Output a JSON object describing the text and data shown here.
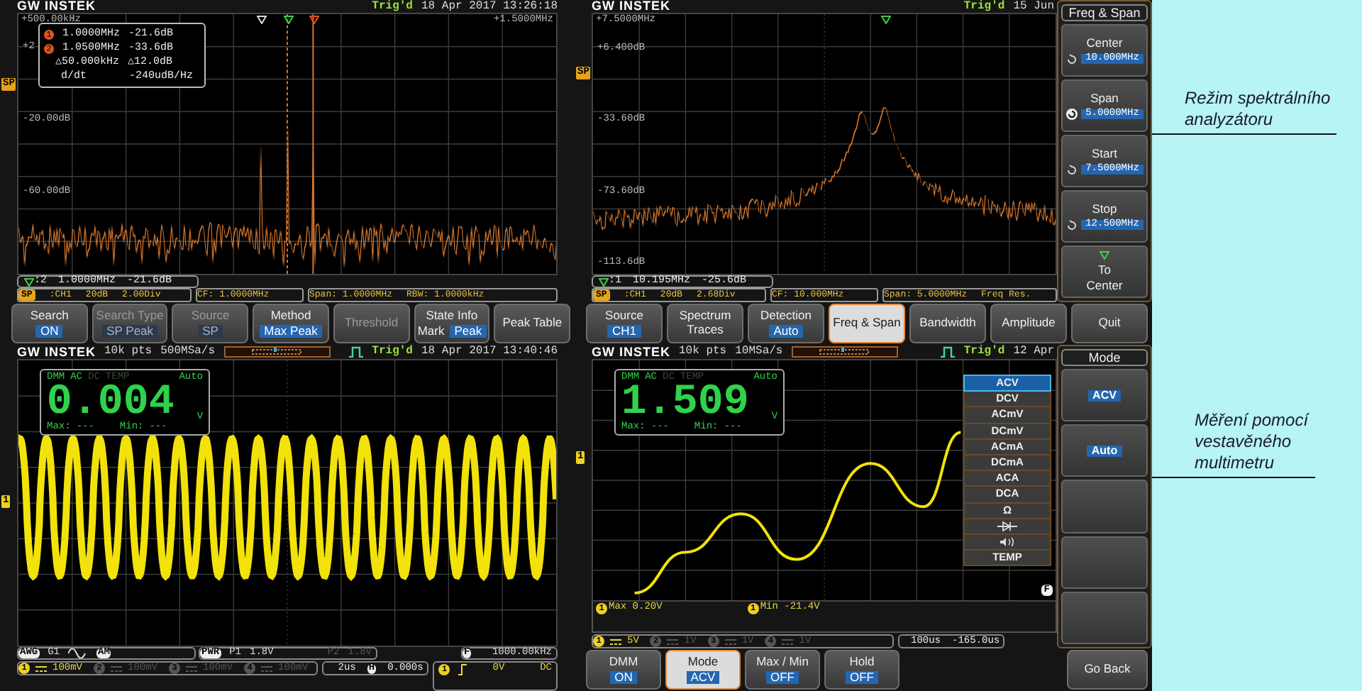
{
  "spectrum_view": {
    "header": {
      "brand": "GW INSTEK",
      "trigger": "Trig'd",
      "datetime": "18 Apr 2017 13:26:18"
    },
    "channel_tag": "SP",
    "x_start": "+500.00kHz",
    "x_end": "+1.5000MHz",
    "y_labels": [
      "+2",
      "-20.00dB",
      "-60.00dB"
    ],
    "marker_table": {
      "rows": [
        {
          "id": "1",
          "freq": "1.0000MHz",
          "level": "-21.6dB"
        },
        {
          "id": "2",
          "freq": "1.0500MHz",
          "level": "-33.6dB"
        }
      ],
      "delta_freq": "△50.000kHz",
      "delta_level": "△12.0dB",
      "rate_label": "d/dt",
      "rate": "-240udB/Hz"
    },
    "readout": {
      "marker": ":2",
      "freq": "1.0000MHz",
      "level": "-21.6dB"
    },
    "status_tag": "SP",
    "status": [
      [
        ":CH1",
        "20dB",
        "2.00Div"
      ],
      [
        "CF: 1.0000MHz"
      ],
      [
        "Span: 1.0000MHz",
        "RBW: 1.0000kHz"
      ]
    ],
    "softkeys": [
      {
        "label": "Search",
        "value": [
          {
            "text": "ON",
            "selected": true
          }
        ],
        "disabled": false,
        "selected": false
      },
      {
        "label": "Search Type",
        "value": [
          {
            "text": "SP Peak",
            "selected": true
          }
        ],
        "disabled": true,
        "selected": false
      },
      {
        "label": "Source",
        "value": [
          {
            "text": "SP",
            "selected": true
          }
        ],
        "disabled": true,
        "selected": false
      },
      {
        "label": "Method",
        "value": [
          {
            "text": "Max Peak",
            "selected": true
          }
        ],
        "disabled": false,
        "selected": false
      },
      {
        "label": "Threshold",
        "disabled": true,
        "selected": false
      },
      {
        "label": "State Info",
        "value": [
          {
            "text": "Mark",
            "selected": false
          },
          {
            "text": "Peak",
            "selected": true
          }
        ],
        "disabled": false,
        "selected": false
      },
      {
        "label": "Peak Table",
        "disabled": false,
        "selected": false
      }
    ]
  },
  "span_view": {
    "header": {
      "brand": "GW INSTEK",
      "trigger": "Trig'd",
      "datetime": "15 Jun"
    },
    "channel_tag": "SP",
    "x_start": "+7.5000MHz",
    "y_labels": [
      "+6.400dB",
      "-33.60dB",
      "-73.60dB",
      "-113.6dB"
    ],
    "readout": {
      "marker": ":1",
      "freq": "10.195MHz",
      "level": "-25.6dB"
    },
    "status_tag": "SP",
    "status": [
      [
        ":CH1",
        "20dB",
        "2.68Div"
      ],
      [
        "CF: 10.000MHz"
      ],
      [
        "Span: 5.0000MHz",
        "Freq Res."
      ]
    ],
    "side_menu": {
      "title": "Freq & Span",
      "items": [
        {
          "kind": "value",
          "label": "Center",
          "value": "10.000MHz",
          "knob_active": false
        },
        {
          "kind": "value",
          "label": "Span",
          "value": "5.0000MHz",
          "knob_active": true
        },
        {
          "kind": "value",
          "label": "Start",
          "value": "7.5000MHz",
          "knob_active": false
        },
        {
          "kind": "value",
          "label": "Stop",
          "value": "12.500MHz",
          "knob_active": false
        },
        {
          "kind": "action",
          "label": "To Center"
        }
      ]
    },
    "softkeys": [
      {
        "label": "Source",
        "value": [
          {
            "text": "CH1",
            "selected": true
          }
        ],
        "disabled": false,
        "selected": false
      },
      {
        "label": "Spectrum Traces",
        "disabled": false,
        "selected": false
      },
      {
        "label": "Detection",
        "value": [
          {
            "text": "Auto",
            "selected": true
          }
        ],
        "disabled": false,
        "selected": false
      },
      {
        "label": "Freq & Span",
        "disabled": false,
        "selected": true
      },
      {
        "label": "Bandwidth",
        "disabled": false,
        "selected": false
      },
      {
        "label": "Amplitude",
        "disabled": false,
        "selected": false
      },
      {
        "label": "Quit",
        "disabled": false,
        "selected": false
      }
    ]
  },
  "dmm_view": {
    "header": {
      "brand": "GW INSTEK",
      "points": "10k pts",
      "rate": "500MSa/s",
      "trigger": "Trig'd",
      "datetime": "18 Apr 2017 13:40:46"
    },
    "channel_tag": "1",
    "dmm": {
      "label": "DMM",
      "modes": [
        {
          "label": "AC",
          "selected": true
        },
        {
          "label": "DC",
          "selected": false
        },
        {
          "label": "TEMP",
          "selected": false
        }
      ],
      "range": "Auto",
      "reading": "0.004",
      "unit": "V",
      "max_label": "Max:",
      "max": "---",
      "min_label": "Min:",
      "min": "---"
    },
    "awg": {
      "tag": "AWG",
      "generator": "G1",
      "modulation": "AM"
    },
    "power": {
      "tag": "PWR",
      "p1": "P1",
      "v1": "1.8V",
      "p2": "P2",
      "v2": "1.8V"
    },
    "counter": {
      "tag": "F",
      "value": "1000.00kHz"
    },
    "channels": [
      {
        "id": "1",
        "scale": "100mV",
        "active": true
      },
      {
        "id": "2",
        "scale": "100mV",
        "active": false
      },
      {
        "id": "3",
        "scale": "100mV",
        "active": false
      },
      {
        "id": "4",
        "scale": "100mV",
        "active": false
      }
    ],
    "timebase": {
      "scale": "2us",
      "tag": "H",
      "offset": "0.000s"
    },
    "trigger": {
      "channel": "1",
      "level": "0V",
      "coupling": "DC"
    }
  },
  "dmm_mode_view": {
    "header": {
      "brand": "GW INSTEK",
      "points": "10k pts",
      "rate": "10MSa/s",
      "trigger": "Trig'd",
      "datetime": "12 Apr"
    },
    "channel_tag": "1",
    "dmm": {
      "label": "DMM",
      "modes": [
        {
          "label": "AC",
          "selected": true
        },
        {
          "label": "DC",
          "selected": false
        },
        {
          "label": "TEMP",
          "selected": false
        }
      ],
      "range": "Auto",
      "reading": "1.509",
      "unit": "V",
      "max_label": "Max:",
      "max": "---",
      "min_label": "Min:",
      "min": "---"
    },
    "mode_list": [
      {
        "kind": "text",
        "label": "ACV",
        "selected": true
      },
      {
        "kind": "text",
        "label": "DCV",
        "selected": false
      },
      {
        "kind": "text",
        "label": "ACmV",
        "selected": false
      },
      {
        "kind": "text",
        "label": "DCmV",
        "selected": false
      },
      {
        "kind": "text",
        "label": "ACmA",
        "selected": false
      },
      {
        "kind": "text",
        "label": "DCmA",
        "selected": false
      },
      {
        "kind": "text",
        "label": "ACA",
        "selected": false
      },
      {
        "kind": "text",
        "label": "DCA",
        "selected": false
      },
      {
        "kind": "text",
        "label": "Ω",
        "selected": false
      },
      {
        "kind": "diode",
        "selected": false
      },
      {
        "kind": "continuity",
        "selected": false
      },
      {
        "kind": "text",
        "label": "TEMP",
        "selected": false
      }
    ],
    "ref_tag": "F",
    "measurements": [
      {
        "channel": "1",
        "text": "Max 0.20V"
      },
      {
        "channel": "1",
        "text": "Min -21.4V"
      }
    ],
    "channels": [
      {
        "id": "1",
        "scale": "5V",
        "active": true
      },
      {
        "id": "2",
        "scale": "1V",
        "active": false
      },
      {
        "id": "3",
        "scale": "1V",
        "active": false
      },
      {
        "id": "4",
        "scale": "1V",
        "active": false
      }
    ],
    "timebase": {
      "scale": "100us",
      "offset": "-165.0us"
    },
    "side_menu": {
      "title": "Mode",
      "items": [
        {
          "kind": "value",
          "value": "ACV"
        },
        {
          "kind": "value",
          "value": "Auto"
        },
        {
          "kind": "blank"
        },
        {
          "kind": "blank"
        },
        {
          "kind": "blank"
        }
      ],
      "back": "Go Back"
    },
    "softkeys": [
      {
        "label": "DMM",
        "value": [
          {
            "text": "ON",
            "selected": true
          }
        ],
        "disabled": false,
        "selected": false
      },
      {
        "label": "Mode",
        "value": [
          {
            "text": "ACV",
            "selected": true
          }
        ],
        "disabled": false,
        "selected": true
      },
      {
        "label": "Max / Min",
        "value": [
          {
            "text": "OFF",
            "selected": true
          }
        ],
        "disabled": false,
        "selected": false
      },
      {
        "label": "Hold",
        "value": [
          {
            "text": "OFF",
            "selected": true
          }
        ],
        "disabled": false,
        "selected": false
      }
    ]
  },
  "annotations": [
    {
      "lines": [
        "Režim spektrálního",
        "analyzátoru"
      ]
    },
    {
      "lines": [
        "Měření pomocí",
        "vestavěného",
        "multimetru"
      ]
    }
  ]
}
